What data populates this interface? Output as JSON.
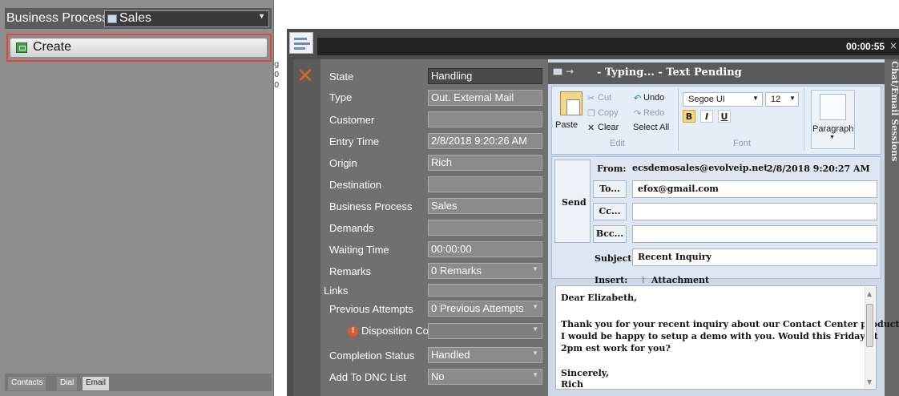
{
  "left_panel": {
    "business_process_label": "Business Process",
    "business_process_value": "Sales",
    "create_label": "Create",
    "tabs": [
      "Contacts",
      "Dial",
      "Email"
    ],
    "edge_text": [
      "g",
      "0",
      "0"
    ]
  },
  "header": {
    "timer": "00:00:55",
    "close_glyph": "×"
  },
  "fields": [
    {
      "label": "State",
      "value": "Handling"
    },
    {
      "label": "Type",
      "value": "Out. External Mail"
    },
    {
      "label": "Customer",
      "value": ""
    },
    {
      "label": "Entry Time",
      "value": "2/8/2018 9:20:26 AM"
    },
    {
      "label": "Origin",
      "value": "Rich"
    },
    {
      "label": "Destination",
      "value": ""
    },
    {
      "label": "Business Process",
      "value": "Sales"
    },
    {
      "label": "Demands",
      "value": ""
    },
    {
      "label": "Waiting Time",
      "value": "00:00:00"
    },
    {
      "label": "Remarks",
      "value": "0 Remarks"
    },
    {
      "label": "Links",
      "value": ""
    },
    {
      "label": "Previous Attempts",
      "value": "0 Previous Attempts"
    },
    {
      "label": "Disposition Code",
      "value": ""
    },
    {
      "label": "Completion Status",
      "value": "Handled"
    },
    {
      "label": "Add To DNC List",
      "value": "No"
    }
  ],
  "email": {
    "title": "- Typing... - Text Pending",
    "side_tab": "Chat/Email Sessions",
    "ribbon": {
      "paste": "Paste",
      "cut": "Cut",
      "copy": "Copy",
      "clear": "Clear",
      "edit_group": "Edit",
      "undo": "Undo",
      "redo": "Redo",
      "select_all": "Select All",
      "font_name": "Segoe UI",
      "font_size": "12",
      "font_group": "Font",
      "bold": "B",
      "italic": "I",
      "underline": "U",
      "paragraph": "Paragraph"
    },
    "send": "Send",
    "from_label": "From:",
    "from_value": "ecsdemosales@evolveip.net",
    "from_date": "2/8/2018 9:20:27 AM",
    "to_btn": "To...",
    "to_value": "efox@gmail.com",
    "cc_btn": "Cc...",
    "bcc_btn": "Bcc...",
    "subject_label": "Subject",
    "subject_value": "Recent Inquiry",
    "insert_label": "Insert:",
    "attachment_label": "Attachment",
    "body_lines": [
      "Dear Elizabeth,",
      "",
      "Thank you for your recent inquiry about our Contact Center products.",
      "I would be happy to setup a demo with you.   Would this Friday at",
      "2pm est work for you?",
      "",
      "Sincerely,",
      "Rich"
    ]
  }
}
